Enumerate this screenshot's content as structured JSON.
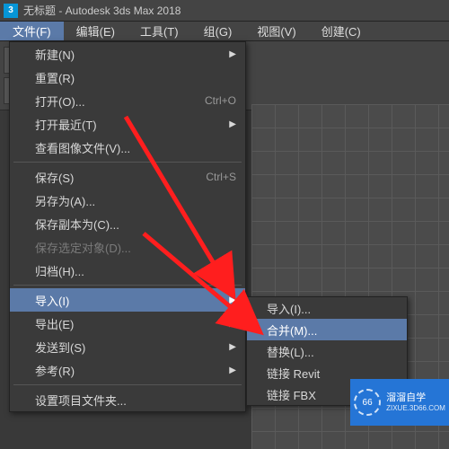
{
  "title_bar": {
    "app_icon": "3",
    "title": "无标题 - Autodesk 3ds Max 2018"
  },
  "menu_bar": {
    "items": [
      {
        "label": "文件(F)",
        "active": true
      },
      {
        "label": "编辑(E)"
      },
      {
        "label": "工具(T)"
      },
      {
        "label": "组(G)"
      },
      {
        "label": "视图(V)"
      },
      {
        "label": "创建(C)"
      }
    ]
  },
  "file_menu": {
    "items": [
      {
        "label": "新建(N)",
        "submenu": true
      },
      {
        "label": "重置(R)"
      },
      {
        "label": "打开(O)...",
        "shortcut": "Ctrl+O"
      },
      {
        "label": "打开最近(T)",
        "submenu": true
      },
      {
        "label": "查看图像文件(V)..."
      },
      {
        "sep": true
      },
      {
        "label": "保存(S)",
        "shortcut": "Ctrl+S"
      },
      {
        "label": "另存为(A)..."
      },
      {
        "label": "保存副本为(C)..."
      },
      {
        "label": "保存选定对象(D)...",
        "disabled": true
      },
      {
        "label": "归档(H)..."
      },
      {
        "sep": true
      },
      {
        "label": "导入(I)",
        "submenu": true,
        "highlight": true
      },
      {
        "label": "导出(E)",
        "submenu": true
      },
      {
        "label": "发送到(S)",
        "submenu": true
      },
      {
        "label": "参考(R)",
        "submenu": true
      },
      {
        "sep": true
      },
      {
        "label": "设置项目文件夹..."
      }
    ]
  },
  "import_submenu": {
    "items": [
      {
        "label": "导入(I)..."
      },
      {
        "label": "合并(M)...",
        "highlight": true
      },
      {
        "label": "替换(L)..."
      },
      {
        "label": "链接 Revit"
      },
      {
        "label": "链接 FBX"
      }
    ]
  },
  "watermark": {
    "brand": "溜溜自学",
    "url": "ZIXUE.3D66.COM"
  },
  "icons": {
    "select": "select-arrow",
    "rect": "rect-select",
    "dashed": "dashed-rect",
    "plus": "plus",
    "fire": "fire",
    "explode": "explode"
  }
}
